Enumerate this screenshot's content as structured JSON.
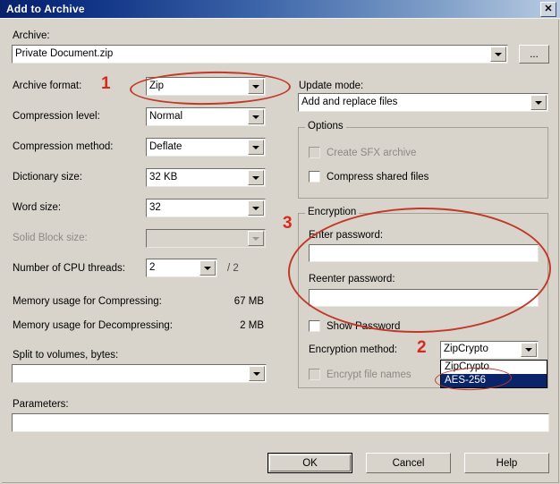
{
  "window": {
    "title": "Add to Archive",
    "close_icon": "close-x-icon"
  },
  "archive": {
    "label": "Archive:",
    "value": "Private Document.zip",
    "browse_label": "...",
    "dropdown_icon": "chevron-down-icon"
  },
  "left_panel": {
    "fields": [
      {
        "label": "Archive format:",
        "value": "Zip",
        "disabled": false
      },
      {
        "label": "Compression level:",
        "value": "Normal",
        "disabled": false
      },
      {
        "label": "Compression method:",
        "value": "Deflate",
        "disabled": false
      },
      {
        "label": "Dictionary size:",
        "value": "32 KB",
        "disabled": false
      },
      {
        "label": "Word size:",
        "value": "32",
        "disabled": false
      },
      {
        "label": "Solid Block size:",
        "value": "",
        "disabled": true
      }
    ],
    "cpu_threads": {
      "label": "Number of CPU threads:",
      "value": "2",
      "max_suffix": "/ 2"
    },
    "memory_compress": {
      "label": "Memory usage for Compressing:",
      "value": "67 MB"
    },
    "memory_decompress": {
      "label": "Memory usage for Decompressing:",
      "value": "2 MB"
    },
    "split": {
      "label": "Split to volumes, bytes:",
      "value": ""
    }
  },
  "right_panel": {
    "update_mode": {
      "label": "Update mode:",
      "value": "Add and replace files"
    },
    "options": {
      "legend": "Options",
      "items": [
        {
          "label": "Create SFX archive",
          "checked": false,
          "disabled": true
        },
        {
          "label": "Compress shared files",
          "checked": false,
          "disabled": false
        }
      ]
    },
    "encryption": {
      "legend": "Encryption",
      "enter_password": {
        "label": "Enter password:",
        "value": ""
      },
      "reenter_password": {
        "label": "Reenter password:",
        "value": ""
      },
      "show_password": {
        "label": "Show Password",
        "checked": false
      },
      "method": {
        "label": "Encryption method:",
        "value": "ZipCrypto",
        "open": true,
        "options": [
          "ZipCrypto",
          "AES-256"
        ],
        "selected": "AES-256"
      },
      "encrypt_file_names": {
        "label": "Encrypt file names",
        "checked": false,
        "disabled": true
      }
    }
  },
  "parameters": {
    "label": "Parameters:",
    "value": ""
  },
  "buttons": {
    "ok": "OK",
    "cancel": "Cancel",
    "help": "Help"
  },
  "annotations": {
    "markers": [
      {
        "number": "1",
        "target": "archive-format-combo"
      },
      {
        "number": "2",
        "target": "encryption-method-combo"
      },
      {
        "number": "3",
        "target": "password-fields"
      }
    ],
    "accent_color": "#c0392b"
  }
}
